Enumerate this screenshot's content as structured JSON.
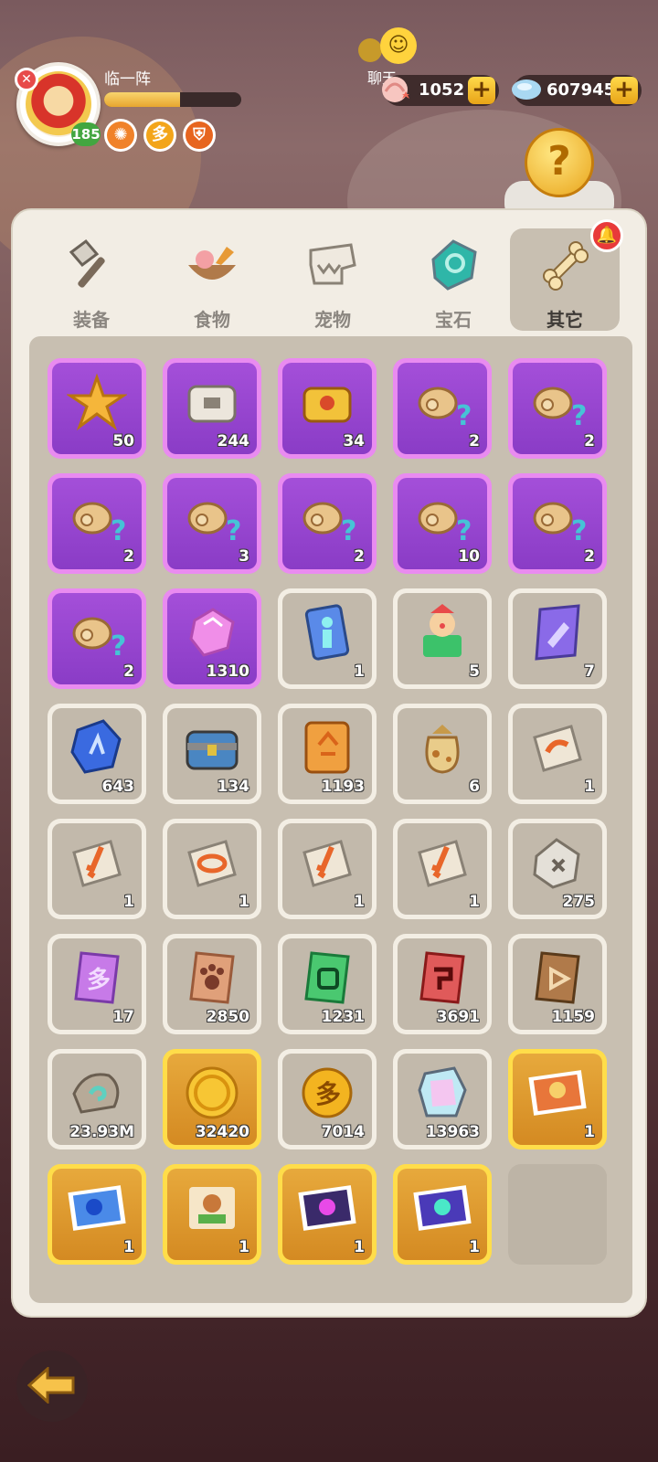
{
  "player": {
    "name": "临一阵",
    "level": "185",
    "xp_fraction": 0.55
  },
  "buffs": [
    {
      "icon": "orange-gear-icon"
    },
    {
      "icon": "gold-token-icon",
      "glyph": "多"
    },
    {
      "icon": "shield-icon"
    }
  ],
  "chat": {
    "label": "聊天"
  },
  "currencies": [
    {
      "icon": "shell-icon",
      "value": "1052",
      "plus": "+"
    },
    {
      "icon": "diamond-icon",
      "value": "607945",
      "plus": "+"
    }
  ],
  "mystery": {
    "glyph": "?"
  },
  "tabs": [
    {
      "label": "装备",
      "icon": "hammer-icon",
      "active": false
    },
    {
      "label": "食物",
      "icon": "food-bowl-icon",
      "active": false
    },
    {
      "label": "宠物",
      "icon": "dino-skull-icon",
      "active": false
    },
    {
      "label": "宝石",
      "icon": "gem-icon",
      "active": false
    },
    {
      "label": "其它",
      "icon": "bone-icon",
      "active": true
    }
  ],
  "items": [
    {
      "icon": "star-totem-icon",
      "count": "50",
      "rarity": "purple"
    },
    {
      "icon": "stone-chest-icon",
      "count": "244",
      "rarity": "purple"
    },
    {
      "icon": "golden-chest-icon",
      "count": "34",
      "rarity": "purple"
    },
    {
      "icon": "mystery-meat-icon",
      "count": "2",
      "rarity": "purple"
    },
    {
      "icon": "mystery-meat-icon",
      "count": "2",
      "rarity": "purple"
    },
    {
      "icon": "mystery-meat-icon",
      "count": "2",
      "rarity": "purple"
    },
    {
      "icon": "mystery-meat-icon",
      "count": "3",
      "rarity": "purple"
    },
    {
      "icon": "mystery-meat-icon",
      "count": "2",
      "rarity": "purple"
    },
    {
      "icon": "mystery-meat-icon",
      "count": "10",
      "rarity": "purple"
    },
    {
      "icon": "mystery-meat-icon",
      "count": "2",
      "rarity": "purple"
    },
    {
      "icon": "mystery-meat-icon",
      "count": "2",
      "rarity": "purple"
    },
    {
      "icon": "pink-crystal-icon",
      "count": "1310",
      "rarity": "purple"
    },
    {
      "icon": "character-card-icon",
      "count": "1",
      "rarity": "grey"
    },
    {
      "icon": "clown-box-icon",
      "count": "5",
      "rarity": "grey"
    },
    {
      "icon": "purple-scroll-icon",
      "count": "7",
      "rarity": "grey"
    },
    {
      "icon": "blue-rune-stone-icon",
      "count": "643",
      "rarity": "grey"
    },
    {
      "icon": "iron-chest-icon",
      "count": "134",
      "rarity": "grey"
    },
    {
      "icon": "orange-map-scroll-icon",
      "count": "1193",
      "rarity": "grey"
    },
    {
      "icon": "loot-sack-icon",
      "count": "6",
      "rarity": "grey"
    },
    {
      "icon": "horn-tablet-icon",
      "count": "1",
      "rarity": "grey"
    },
    {
      "icon": "sword-tablet-icon",
      "count": "1",
      "rarity": "grey"
    },
    {
      "icon": "ring-tablet-icon",
      "count": "1",
      "rarity": "grey"
    },
    {
      "icon": "sword-tablet-icon",
      "count": "1",
      "rarity": "grey"
    },
    {
      "icon": "sword-tablet-icon",
      "count": "1",
      "rarity": "grey"
    },
    {
      "icon": "stone-dice-icon",
      "count": "275",
      "rarity": "grey"
    },
    {
      "icon": "purple-ticket-icon",
      "count": "17",
      "rarity": "grey"
    },
    {
      "icon": "paw-ticket-icon",
      "count": "2850",
      "rarity": "grey"
    },
    {
      "icon": "green-ticket-icon",
      "count": "1231",
      "rarity": "grey"
    },
    {
      "icon": "red-ticket-icon",
      "count": "3691",
      "rarity": "grey"
    },
    {
      "icon": "brown-ticket-icon",
      "count": "1159",
      "rarity": "grey"
    },
    {
      "icon": "swirl-stone-icon",
      "count": "23.93M",
      "rarity": "grey"
    },
    {
      "icon": "gold-coin-icon",
      "count": "32420",
      "rarity": "gold"
    },
    {
      "icon": "gold-token-icon",
      "count": "7014",
      "rarity": "grey"
    },
    {
      "icon": "rainbow-crystal-icon",
      "count": "13963",
      "rarity": "grey"
    },
    {
      "icon": "hero-photo-card-icon",
      "count": "1",
      "rarity": "gold"
    },
    {
      "icon": "sonic-photo-card-icon",
      "count": "1",
      "rarity": "gold"
    },
    {
      "icon": "desert-photo-card-icon",
      "count": "1",
      "rarity": "gold"
    },
    {
      "icon": "neon-photo-card-icon",
      "count": "1",
      "rarity": "gold"
    },
    {
      "icon": "blue-photo-card-icon",
      "count": "1",
      "rarity": "gold"
    },
    {
      "icon": "",
      "count": "",
      "rarity": "empty"
    }
  ],
  "colors": {
    "accent": "#e8a418",
    "purple_slot": "#a44fd9",
    "gold_slot": "#e7a93c",
    "panel": "#f2ede4"
  }
}
